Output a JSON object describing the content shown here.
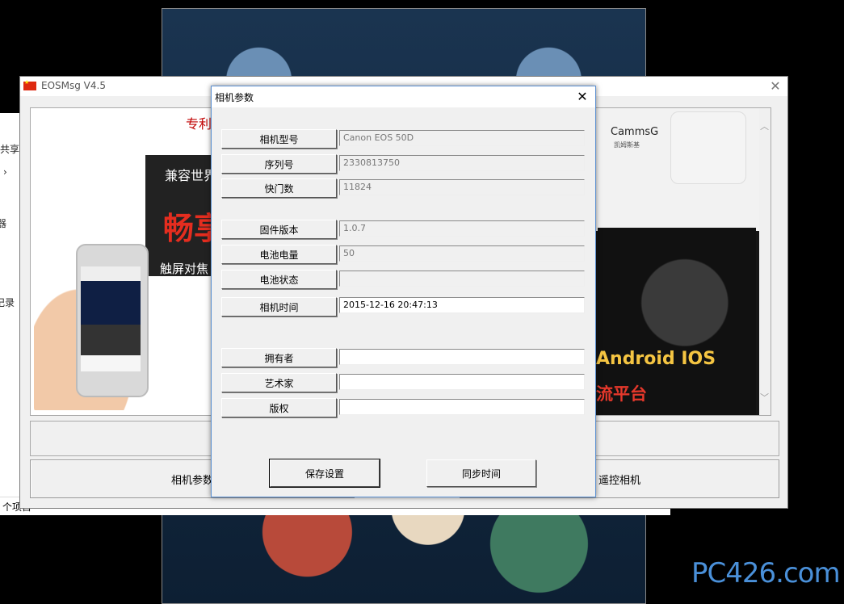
{
  "explorer": {
    "share": "共享",
    "arrow": "›",
    "item_a": "器",
    "item_b": "记录",
    "status": "个项目"
  },
  "main_window": {
    "title": "EOSMsg V4.5",
    "close": "✕",
    "banner": {
      "top_red": "专利",
      "line1": "兼容世界",
      "line2": "畅享",
      "line3": "触屏对焦",
      "brand": "CammsG",
      "brand_sub": "凯姆斯基",
      "platform_line1": "Android IOS",
      "platform_line2": "流平台"
    },
    "scroll_up": "︿",
    "scroll_down": "﹀",
    "bottom_buttons": {
      "camera_params": "相机参数",
      "remote_control": "遥控相机"
    }
  },
  "dialog": {
    "title": "相机参数",
    "close": "✕",
    "rows": [
      {
        "label": "相机型号",
        "value": "Canon EOS 50D"
      },
      {
        "label": "序列号",
        "value": "2330813750"
      },
      {
        "label": "快门数",
        "value": "11824"
      },
      {
        "label": "固件版本",
        "value": "1.0.7"
      },
      {
        "label": "电池电量",
        "value": "50"
      },
      {
        "label": "电池状态",
        "value": ""
      },
      {
        "label": "相机时间",
        "value": "2015-12-16 20:47:13"
      },
      {
        "label": "拥有者",
        "value": ""
      },
      {
        "label": "艺术家",
        "value": ""
      },
      {
        "label": "版权",
        "value": ""
      }
    ],
    "save_button": "保存设置",
    "sync_button": "同步时间"
  },
  "watermark": "PC426.com"
}
